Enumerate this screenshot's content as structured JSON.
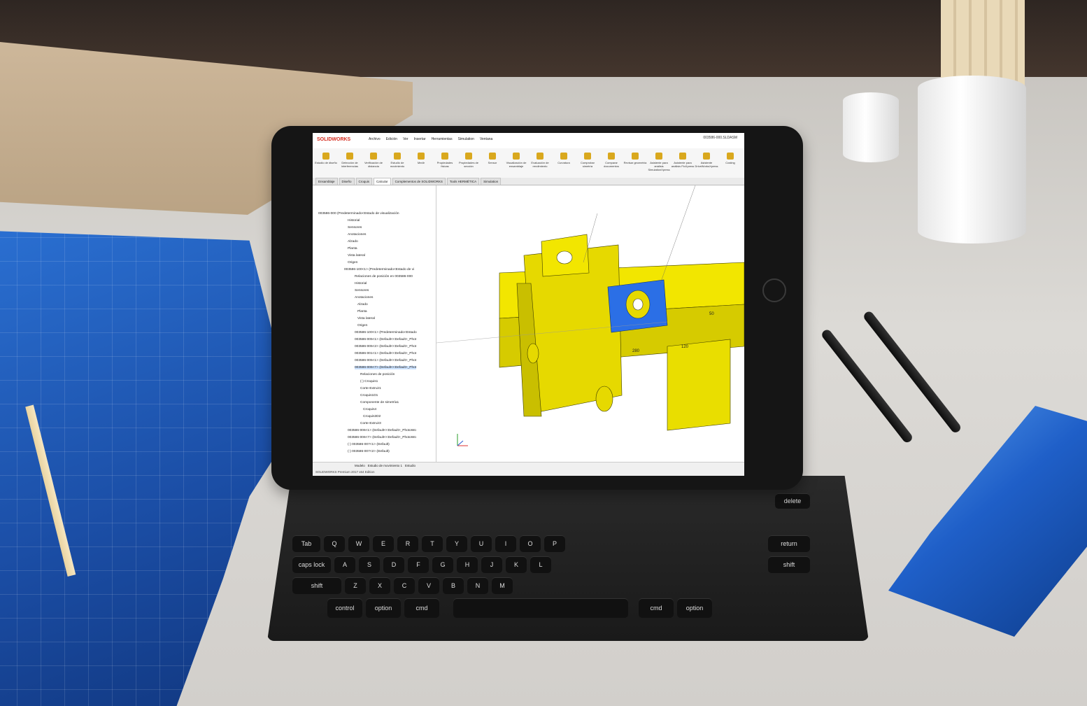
{
  "solidworks": {
    "logo": "SOLIDWORKS",
    "file_name": "003586-000.SLDASM",
    "menu": [
      "Archivo",
      "Edición",
      "Ver",
      "Insertar",
      "Herramientas",
      "Simulation",
      "Ventana"
    ],
    "ribbon": [
      "Estudio de diseño",
      "Detección de interferencias",
      "Verificación de distancia",
      "Estudio de movimiento",
      "Medir",
      "Propiedades físicas",
      "Propiedades de sección",
      "Sensor",
      "Visualización de ensamblaje",
      "Evaluación de rendimiento",
      "Curvatura",
      "Comprobar simetría",
      "Comparar documentos",
      "Revisar geometría",
      "Asistente para análisis SimulationXpress",
      "Asistente para análisis FloXpress",
      "Asistente DriveWorksXpress",
      "Costing"
    ],
    "tabs": [
      "Ensamblaje",
      "Diseño",
      "Croquis",
      "Calcular",
      "Complementos de SOLIDWORKS",
      "Tools HERMÉTICA",
      "Simulation"
    ],
    "tree": [
      "003586-000 (Predeterminado<Estado de visualización",
      "Historial",
      "Sensores",
      "Anotaciones",
      "Alzado",
      "Planta",
      "Vista lateral",
      "Origen",
      "003586-100<1> (Predeterminado<Estado de vi",
      "Relaciones de posición en 003586-000",
      "Historial",
      "Sensores",
      "Anotaciones",
      "Alzado",
      "Planta",
      "Vista lateral",
      "Origen",
      "003586-100<1> (Predeterminado<Estado",
      "003586-005<1> (Default<<Default>_Phot",
      "003586-005<2> (Default<<Default>_Phot",
      "003586-001<1> (Default<<Default>_Phot",
      "003586-005<1> (Default<<Default>_Phot",
      "003586-006<7> (Default<<Default>_Phot",
      "Relaciones de posición",
      "(-) Croquis1",
      "Corte-Extruir1",
      "Croquis1D1",
      "Componente de simetría1",
      "Croquis4",
      "Croquis3D2",
      "Corte-Extruir3",
      "003586-006<1> (Default<<Default>_PhotoWo",
      "003586-006<7> (Default<<Default>_PhotoWo",
      "(-) 003586-007<1> (Default)",
      "(-) 003586-007<2> (Default)"
    ],
    "bottom_tabs": [
      "Modelo",
      "Estudio de movimiento 1",
      "Estudio"
    ],
    "status": "SOLIDWORKS Premium 2017 x64 Edition",
    "dimensions": [
      "280",
      "120",
      "50"
    ]
  },
  "keyboard": {
    "keys": [
      "Tab",
      "Q",
      "W",
      "E",
      "R",
      "T",
      "Y",
      "U",
      "I",
      "O",
      "P",
      "caps lock",
      "A",
      "S",
      "D",
      "F",
      "G",
      "H",
      "J",
      "K",
      "L",
      "return",
      "shift",
      "Z",
      "X",
      "C",
      "V",
      "B",
      "N",
      "M",
      "shift",
      "control",
      "option",
      "cmd",
      "cmd",
      "option",
      "delete"
    ]
  },
  "colors": {
    "model_yellow": "#f2e600",
    "model_blue": "#2b6fe6",
    "blueprint": "#1f5fc8",
    "solidworks_red": "#d52b1e"
  }
}
